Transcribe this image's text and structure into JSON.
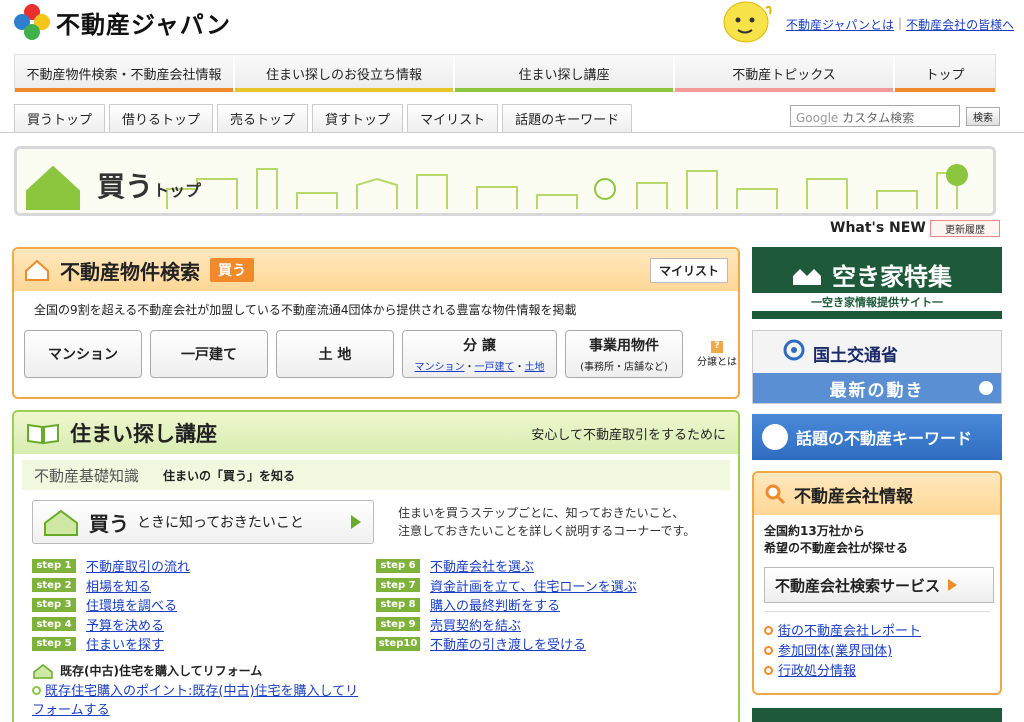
{
  "header": {
    "logo_text": "不動産ジャパン",
    "links": [
      "不動産ジャパンとは",
      "不動産会社の皆様へ"
    ]
  },
  "main_nav": [
    "不動産物件検索・不動産会社情報",
    "住まい探しのお役立ち情報",
    "住まい探し講座",
    "不動産トピックス",
    "トップ"
  ],
  "sub_tabs": [
    "買うトップ",
    "借りるトップ",
    "売るトップ",
    "貸すトップ",
    "マイリスト",
    "話題のキーワード"
  ],
  "search": {
    "placeholder_google": "Google",
    "placeholder_text": "カスタム検索",
    "button": "検索"
  },
  "banner": {
    "title": "買う",
    "title_small": "トップ"
  },
  "whats_new": {
    "label": "What's NEW",
    "history": "更新履歴"
  },
  "property_search": {
    "title": "不動産物件検索",
    "badge": "買う",
    "mylist": "マイリスト",
    "description": "全国の9割を超える不動産会社が加盟している不動産流通4団体から提供される豊富な物件情報を掲載",
    "buttons": {
      "mansion": "マンション",
      "house": "一戸建て",
      "land": "土 地",
      "bunjo": "分 譲",
      "bunjo_links": [
        "マンション",
        "一戸建て",
        "土地"
      ],
      "business": "事業用物件",
      "business_sub": "(事務所・店舗など)"
    },
    "bunjo_note": "分譲とは"
  },
  "housing_course": {
    "title": "住まい探し講座",
    "tagline": "安心して不動産取引をするために",
    "sub_a": "不動産基礎知識",
    "sub_b": "住まいの「買う」を知る",
    "buy_box": {
      "big": "買う",
      "rest": "ときに知っておきたいこと"
    },
    "buy_desc_1": "住まいを買うステップごとに、知っておきたいこと、",
    "buy_desc_2": "注意しておきたいことを詳しく説明するコーナーです。",
    "steps_left": [
      {
        "badge": "step 1",
        "label": "不動産取引の流れ"
      },
      {
        "badge": "step 2",
        "label": "相場を知る"
      },
      {
        "badge": "step 3",
        "label": "住環境を調べる"
      },
      {
        "badge": "step 4",
        "label": "予算を決める"
      },
      {
        "badge": "step 5",
        "label": "住まいを探す"
      }
    ],
    "steps_right": [
      {
        "badge": "step 6",
        "label": "不動産会社を選ぶ"
      },
      {
        "badge": "step 7",
        "label": "資金計画を立て、住宅ローンを選ぶ"
      },
      {
        "badge": "step 8",
        "label": "購入の最終判断をする"
      },
      {
        "badge": "step 9",
        "label": "売買契約を結ぶ"
      },
      {
        "badge": "step10",
        "label": "不動産の引き渡しを受ける"
      }
    ],
    "reform_heading": "既存(中古)住宅を購入してリフォーム",
    "reform_link": "既存住宅購入のポイント:既存(中古)住宅を購入してリフォームする"
  },
  "akiya": {
    "title": "空き家特集",
    "sub": "一空き家情報提供サイト一"
  },
  "mlit": {
    "title": "国土交通省",
    "button": "最新の動き"
  },
  "keyword_banner": "話題の不動産キーワード",
  "company": {
    "title": "不動産会社情報",
    "desc_1": "全国約13万社から",
    "desc_2": "希望の不動産会社が探せる",
    "button": "不動産会社検索サービス",
    "links": [
      "街の不動産会社レポート",
      "参加団体(業界団体)",
      "行政処分情報"
    ]
  },
  "colors": {
    "orange": "#f08a2a",
    "green": "#8cc63f",
    "dark_green": "#1e5a3a",
    "link": "#1a3fc4"
  }
}
